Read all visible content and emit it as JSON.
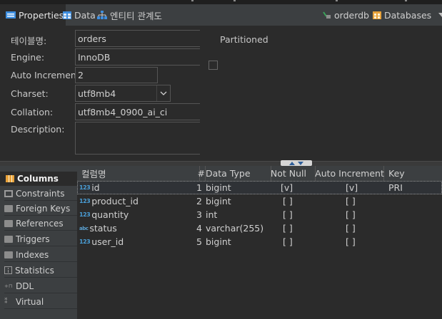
{
  "tabs": {
    "properties": "Properties",
    "data": "Data",
    "er_diagram": "엔티티 관계도",
    "db_badge": "orderdb",
    "databases": "Databases"
  },
  "properties": {
    "table_name_label": "테이블명:",
    "table_name_value": "orders",
    "engine_label": "Engine:",
    "engine_value": "InnoDB",
    "auto_increment_label": "Auto Increment:",
    "auto_increment_value": "2",
    "charset_label": "Charset:",
    "charset_value": "utf8mb4",
    "collation_label": "Collation:",
    "collation_value": "utf8mb4_0900_ai_ci",
    "description_label": "Description:",
    "description_value": "",
    "partitioned_label": "Partitioned",
    "partitioned_checked": false
  },
  "sidebar": {
    "items": [
      {
        "label": "Columns",
        "icon": "columns-icon",
        "active": true
      },
      {
        "label": "Constraints",
        "icon": "constraints-icon"
      },
      {
        "label": "Foreign Keys",
        "icon": "foreign-keys-icon"
      },
      {
        "label": "References",
        "icon": "references-icon"
      },
      {
        "label": "Triggers",
        "icon": "triggers-icon"
      },
      {
        "label": "Indexes",
        "icon": "indexes-icon"
      },
      {
        "label": "Statistics",
        "icon": "statistics-icon"
      },
      {
        "label": "DDL",
        "icon": "ddl-icon"
      },
      {
        "label": "Virtual",
        "icon": "virtual-icon"
      }
    ]
  },
  "columns_table": {
    "headers": {
      "name": "컬럼명",
      "num": "#",
      "type": "Data Type",
      "notnull": "Not Null",
      "autoinc": "Auto Increment",
      "key": "Key"
    },
    "rows": [
      {
        "type_icon": "123",
        "name": "id",
        "num": "1",
        "data_type": "bigint",
        "not_null": "[v]",
        "auto_inc": "[v]",
        "key": "PRI"
      },
      {
        "type_icon": "123",
        "name": "product_id",
        "num": "2",
        "data_type": "bigint",
        "not_null": "[ ]",
        "auto_inc": "[ ]",
        "key": ""
      },
      {
        "type_icon": "123",
        "name": "quantity",
        "num": "3",
        "data_type": "int",
        "not_null": "[ ]",
        "auto_inc": "[ ]",
        "key": ""
      },
      {
        "type_icon": "abc",
        "name": "status",
        "num": "4",
        "data_type": "varchar(255)",
        "not_null": "[ ]",
        "auto_inc": "[ ]",
        "key": ""
      },
      {
        "type_icon": "123",
        "name": "user_id",
        "num": "5",
        "data_type": "bigint",
        "not_null": "[ ]",
        "auto_inc": "[ ]",
        "key": ""
      }
    ]
  },
  "colors": {
    "background": "#2b2b2b",
    "panel": "#3c3f41",
    "accent_blue": "#4a9fd8",
    "database_orange": "#e8a23a",
    "er_icon_blue": "#3d8ee0"
  }
}
